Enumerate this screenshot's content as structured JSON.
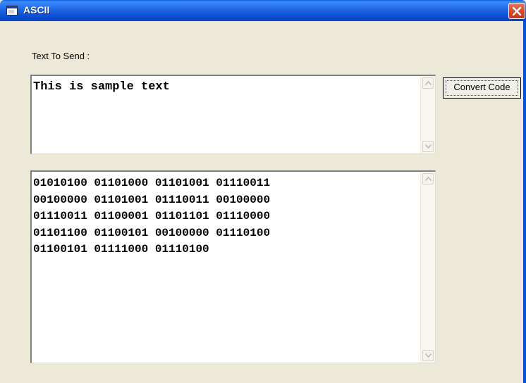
{
  "window": {
    "title": "ASCII"
  },
  "form": {
    "send_label": "Text To Send :",
    "send_text": "This is sample text",
    "convert_button": "Convert Code",
    "binary_output": "01010100 01101000 01101001 01110011\n00100000 01101001 01110011 00100000\n01110011 01100001 01101101 01110000\n01101100 01100101 00100000 01110100\n01100101 01111000 01110100"
  },
  "colors": {
    "title_bar": "#0b4fd4",
    "window_bg": "#ece9d8",
    "close_button": "#d8472a"
  },
  "icons": {
    "app": "window-app-icon",
    "close": "close-icon",
    "scroll_up": "scroll-up-arrow-icon",
    "scroll_down": "scroll-down-arrow-icon"
  }
}
